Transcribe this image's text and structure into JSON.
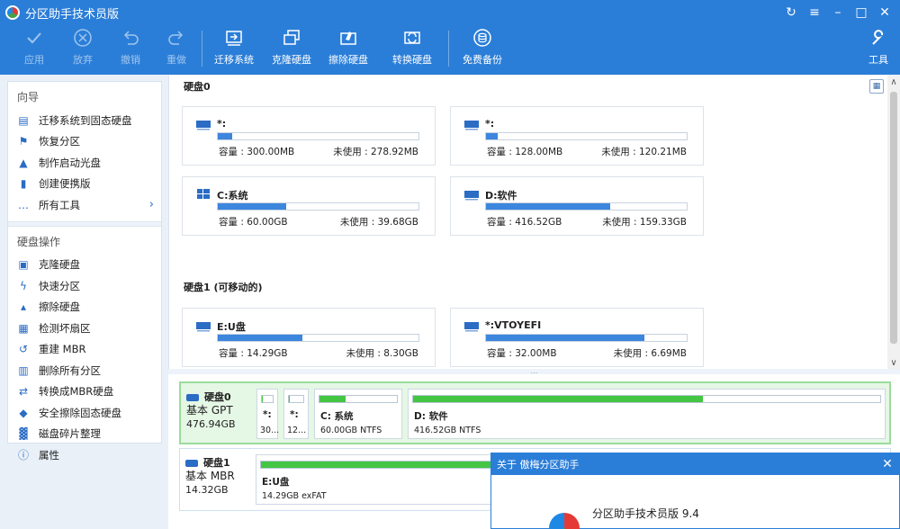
{
  "window": {
    "title": "分区助手技术员版",
    "controls": [
      "refresh",
      "menu",
      "minimize",
      "maximize",
      "close"
    ]
  },
  "toolbar": {
    "apply": "应用",
    "discard": "放弃",
    "undo": "撤销",
    "redo": "重做",
    "migrate_os": "迁移系统",
    "clone_disk": "克隆硬盘",
    "wipe_disk": "擦除硬盘",
    "convert_disk": "转换硬盘",
    "free_backup": "免费备份",
    "tools": "工具"
  },
  "sidebar": {
    "wizard_title": "向导",
    "wizard_items": [
      {
        "label": "迁移系统到固态硬盘",
        "icon": "migrate-icon"
      },
      {
        "label": "恢复分区",
        "icon": "recover-icon"
      },
      {
        "label": "制作启动光盘",
        "icon": "bootable-media-icon"
      },
      {
        "label": "创建便携版",
        "icon": "portable-icon"
      },
      {
        "label": "所有工具",
        "icon": "more-icon"
      }
    ],
    "ops_title": "硬盘操作",
    "ops_items": [
      {
        "label": "克隆硬盘",
        "icon": "clone-icon"
      },
      {
        "label": "快速分区",
        "icon": "lightning-icon"
      },
      {
        "label": "擦除硬盘",
        "icon": "wipe-icon"
      },
      {
        "label": "检测坏扇区",
        "icon": "scan-icon"
      },
      {
        "label": "重建 MBR",
        "icon": "rebuild-icon"
      },
      {
        "label": "删除所有分区",
        "icon": "delete-icon"
      },
      {
        "label": "转换成MBR硬盘",
        "icon": "convert-icon"
      },
      {
        "label": "安全擦除固态硬盘",
        "icon": "erase-icon"
      },
      {
        "label": "磁盘碎片整理",
        "icon": "defrag-icon"
      },
      {
        "label": "属性",
        "icon": "info-icon"
      }
    ]
  },
  "disks_panel": {
    "disk0_title": "硬盘0",
    "disk1_title": "硬盘1 (可移动的)",
    "cap_label": "容量 : ",
    "free_label": "未使用 : ",
    "disk0_partitions": [
      {
        "name": "*:",
        "capacity": "300.00MB",
        "free": "278.92MB",
        "used_fraction": 0.07,
        "icon": "hdd-icon"
      },
      {
        "name": "*:",
        "capacity": "128.00MB",
        "free": "120.21MB",
        "used_fraction": 0.06,
        "icon": "hdd-icon"
      },
      {
        "name": "C:系统",
        "capacity": "60.00GB",
        "free": "39.68GB",
        "used_fraction": 0.34,
        "icon": "windows-icon"
      },
      {
        "name": "D:软件",
        "capacity": "416.52GB",
        "free": "159.33GB",
        "used_fraction": 0.62,
        "icon": "hdd-icon"
      }
    ],
    "disk1_partitions": [
      {
        "name": "E:U盘",
        "capacity": "14.29GB",
        "free": "8.30GB",
        "used_fraction": 0.42,
        "icon": "hdd-icon"
      },
      {
        "name": "*:VTOYEFI",
        "capacity": "32.00MB",
        "free": "6.69MB",
        "used_fraction": 0.79,
        "icon": "hdd-icon"
      }
    ]
  },
  "disk_map": {
    "disk0": {
      "name": "硬盘0",
      "type": "基本 GPT",
      "size": "476.94GB",
      "partitions": [
        {
          "name": "*:",
          "detail": "30...",
          "used_fraction": 0.07
        },
        {
          "name": "*:",
          "detail": "12...",
          "used_fraction": 0.06
        },
        {
          "name": "C: 系统",
          "detail": "60.00GB NTFS",
          "used_fraction": 0.34
        },
        {
          "name": "D: 软件",
          "detail": "416.52GB NTFS",
          "used_fraction": 0.62
        }
      ]
    },
    "disk1": {
      "name": "硬盘1",
      "type": "基本 MBR",
      "size": "14.32GB",
      "partitions": [
        {
          "name": "E:U盘",
          "detail": "14.29GB exFAT",
          "used_fraction": 0.42
        }
      ]
    }
  },
  "about_dialog": {
    "title": "关于 傲梅分区助手",
    "product": "分区助手技术员版 9.4"
  }
}
